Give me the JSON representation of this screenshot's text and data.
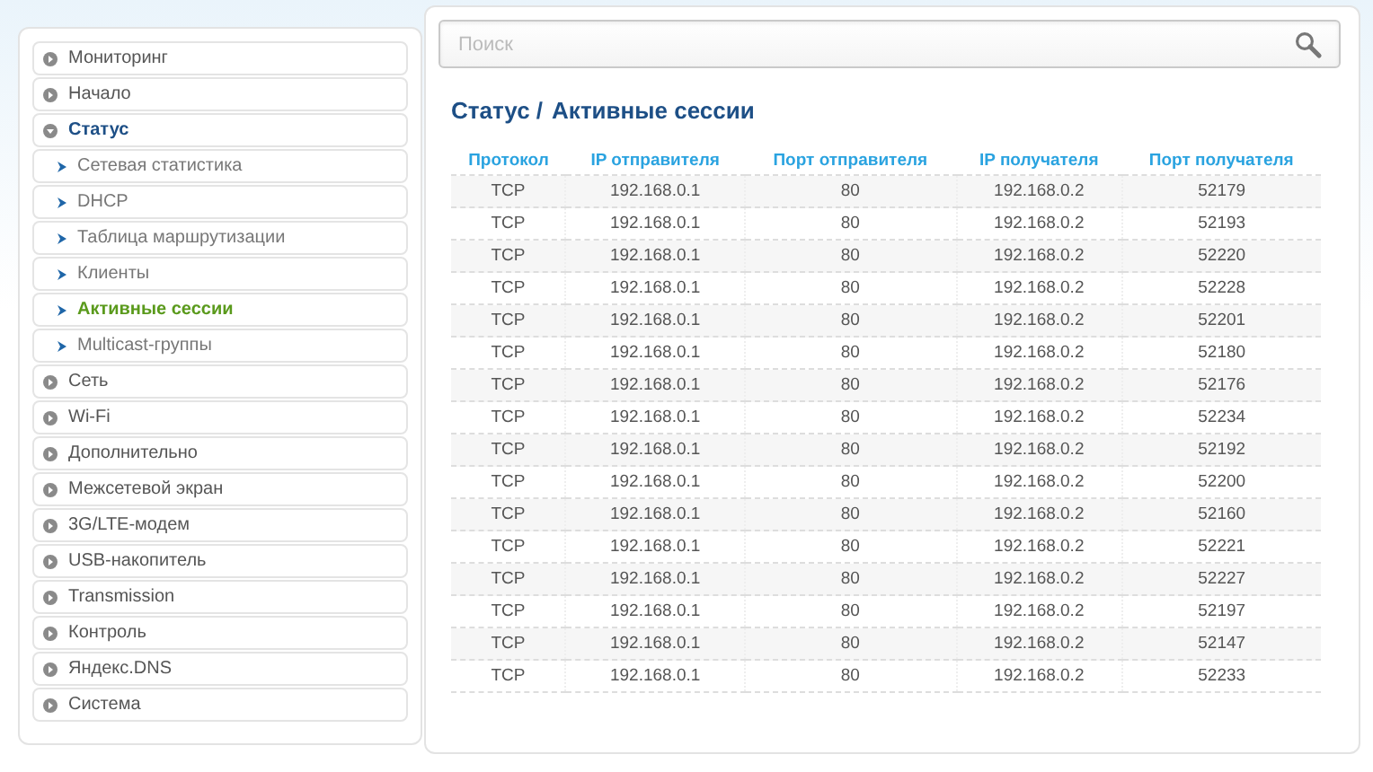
{
  "sidebar": {
    "items": [
      {
        "label": "Мониторинг",
        "expanded": false
      },
      {
        "label": "Начало",
        "expanded": false
      },
      {
        "label": "Статус",
        "expanded": true,
        "children": [
          {
            "label": "Сетевая статистика",
            "selected": false
          },
          {
            "label": "DHCP",
            "selected": false
          },
          {
            "label": "Таблица маршрутизации",
            "selected": false
          },
          {
            "label": "Клиенты",
            "selected": false
          },
          {
            "label": "Активные сессии",
            "selected": true
          },
          {
            "label": "Multicast-группы",
            "selected": false
          }
        ]
      },
      {
        "label": "Сеть",
        "expanded": false
      },
      {
        "label": "Wi-Fi",
        "expanded": false
      },
      {
        "label": "Дополнительно",
        "expanded": false
      },
      {
        "label": "Межсетевой экран",
        "expanded": false
      },
      {
        "label": "3G/LTE-модем",
        "expanded": false
      },
      {
        "label": "USB-накопитель",
        "expanded": false
      },
      {
        "label": "Transmission",
        "expanded": false
      },
      {
        "label": "Контроль",
        "expanded": false
      },
      {
        "label": "Яндекс.DNS",
        "expanded": false
      },
      {
        "label": "Система",
        "expanded": false
      }
    ]
  },
  "search": {
    "placeholder": "Поиск"
  },
  "breadcrumb": {
    "parent": "Статус /",
    "current": "Активные сессии"
  },
  "table": {
    "columns": [
      "Протокол",
      "IP отправителя",
      "Порт отправителя",
      "IP получателя",
      "Порт получателя"
    ],
    "rows": [
      [
        "TCP",
        "192.168.0.1",
        "80",
        "192.168.0.2",
        "52179"
      ],
      [
        "TCP",
        "192.168.0.1",
        "80",
        "192.168.0.2",
        "52193"
      ],
      [
        "TCP",
        "192.168.0.1",
        "80",
        "192.168.0.2",
        "52220"
      ],
      [
        "TCP",
        "192.168.0.1",
        "80",
        "192.168.0.2",
        "52228"
      ],
      [
        "TCP",
        "192.168.0.1",
        "80",
        "192.168.0.2",
        "52201"
      ],
      [
        "TCP",
        "192.168.0.1",
        "80",
        "192.168.0.2",
        "52180"
      ],
      [
        "TCP",
        "192.168.0.1",
        "80",
        "192.168.0.2",
        "52176"
      ],
      [
        "TCP",
        "192.168.0.1",
        "80",
        "192.168.0.2",
        "52234"
      ],
      [
        "TCP",
        "192.168.0.1",
        "80",
        "192.168.0.2",
        "52192"
      ],
      [
        "TCP",
        "192.168.0.1",
        "80",
        "192.168.0.2",
        "52200"
      ],
      [
        "TCP",
        "192.168.0.1",
        "80",
        "192.168.0.2",
        "52160"
      ],
      [
        "TCP",
        "192.168.0.1",
        "80",
        "192.168.0.2",
        "52221"
      ],
      [
        "TCP",
        "192.168.0.1",
        "80",
        "192.168.0.2",
        "52227"
      ],
      [
        "TCP",
        "192.168.0.1",
        "80",
        "192.168.0.2",
        "52197"
      ],
      [
        "TCP",
        "192.168.0.1",
        "80",
        "192.168.0.2",
        "52147"
      ],
      [
        "TCP",
        "192.168.0.1",
        "80",
        "192.168.0.2",
        "52233"
      ]
    ]
  }
}
